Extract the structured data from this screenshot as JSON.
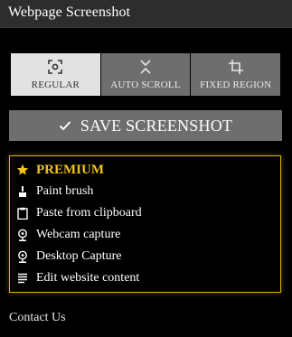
{
  "header": {
    "title": "Webpage Screenshot"
  },
  "capture_modes": [
    {
      "label": "REGULAR",
      "icon": "regular-capture-icon",
      "active": true
    },
    {
      "label": "AUTO SCROLL",
      "icon": "auto-scroll-icon",
      "active": false
    },
    {
      "label": "FIXED REGION",
      "icon": "crop-icon",
      "active": false
    }
  ],
  "save_button": {
    "label": "SAVE SCREENSHOT",
    "icon": "check-icon"
  },
  "premium": {
    "title": "PREMIUM",
    "icon": "star-icon",
    "features": [
      {
        "label": "Paint brush",
        "icon": "brush-icon"
      },
      {
        "label": "Paste from clipboard",
        "icon": "clipboard-icon"
      },
      {
        "label": "Webcam capture",
        "icon": "webcam-icon"
      },
      {
        "label": "Desktop Capture",
        "icon": "webcam-icon"
      },
      {
        "label": "Edit website content",
        "icon": "edit-lines-icon"
      }
    ]
  },
  "footer": {
    "contact_label": "Contact Us"
  },
  "colors": {
    "background": "#000000",
    "header": "#2d2d2d",
    "mode_inactive": "#6e6e6e",
    "mode_active": "#e2e2e2",
    "accent_gold": "#f2c21a",
    "premium_border": "#e0b100"
  }
}
